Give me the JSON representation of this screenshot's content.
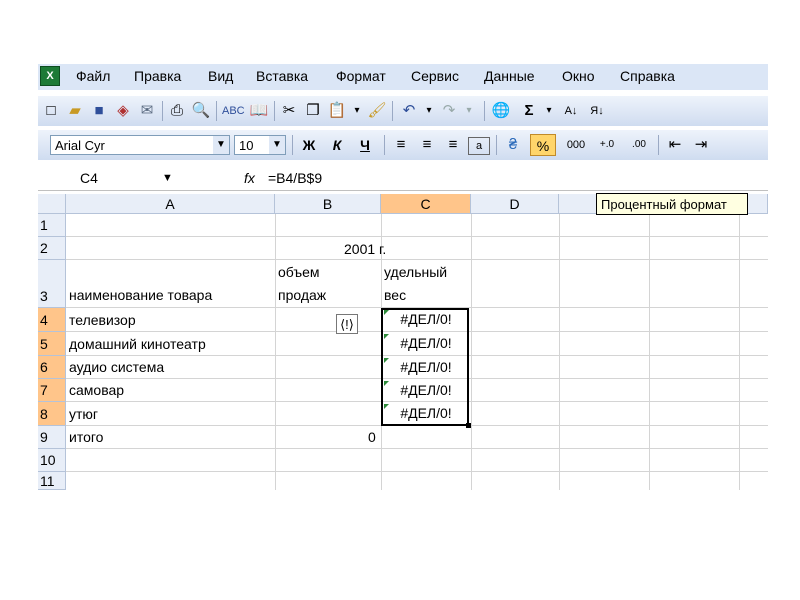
{
  "menu": [
    "Файл",
    "Правка",
    "Вид",
    "Вставка",
    "Формат",
    "Сервис",
    "Данные",
    "Окно",
    "Справка"
  ],
  "toolbar": {
    "font_name": "Arial Cyr",
    "font_size": "10",
    "bold_label": "Ж",
    "italic_label": "К",
    "underline_label": "Ч",
    "percent_label": "%",
    "thousands_label": "000"
  },
  "formula_bar": {
    "name_box": "C4",
    "fx": "fx",
    "formula": "=B4/B$9"
  },
  "tooltip": "Процентный формат",
  "columns": [
    "A",
    "B",
    "C",
    "D"
  ],
  "rows": [
    "1",
    "2",
    "3",
    "4",
    "5",
    "6",
    "7",
    "8",
    "9",
    "10",
    "11"
  ],
  "cells": {
    "B2": "2001 г.",
    "A3": "наименование товара",
    "B3_line1": "объем",
    "B3_line2": "продаж",
    "C3_line1": "удельный",
    "C3_line2": "вес",
    "A4": "телевизор",
    "A5": "домашний кинотеатр",
    "A6": "аудио система",
    "A7": "самовар",
    "A8": "утюг",
    "A9": "итого",
    "B9": "0",
    "C4": "#ДЕЛ/0!",
    "C5": "#ДЕЛ/0!",
    "C6": "#ДЕЛ/0!",
    "C7": "#ДЕЛ/0!",
    "C8": "#ДЕЛ/0!"
  },
  "colors": {
    "accent": "#ffc58a",
    "menu_bg": "#dbe6f6",
    "error_triangle": "#2d8a3a"
  }
}
